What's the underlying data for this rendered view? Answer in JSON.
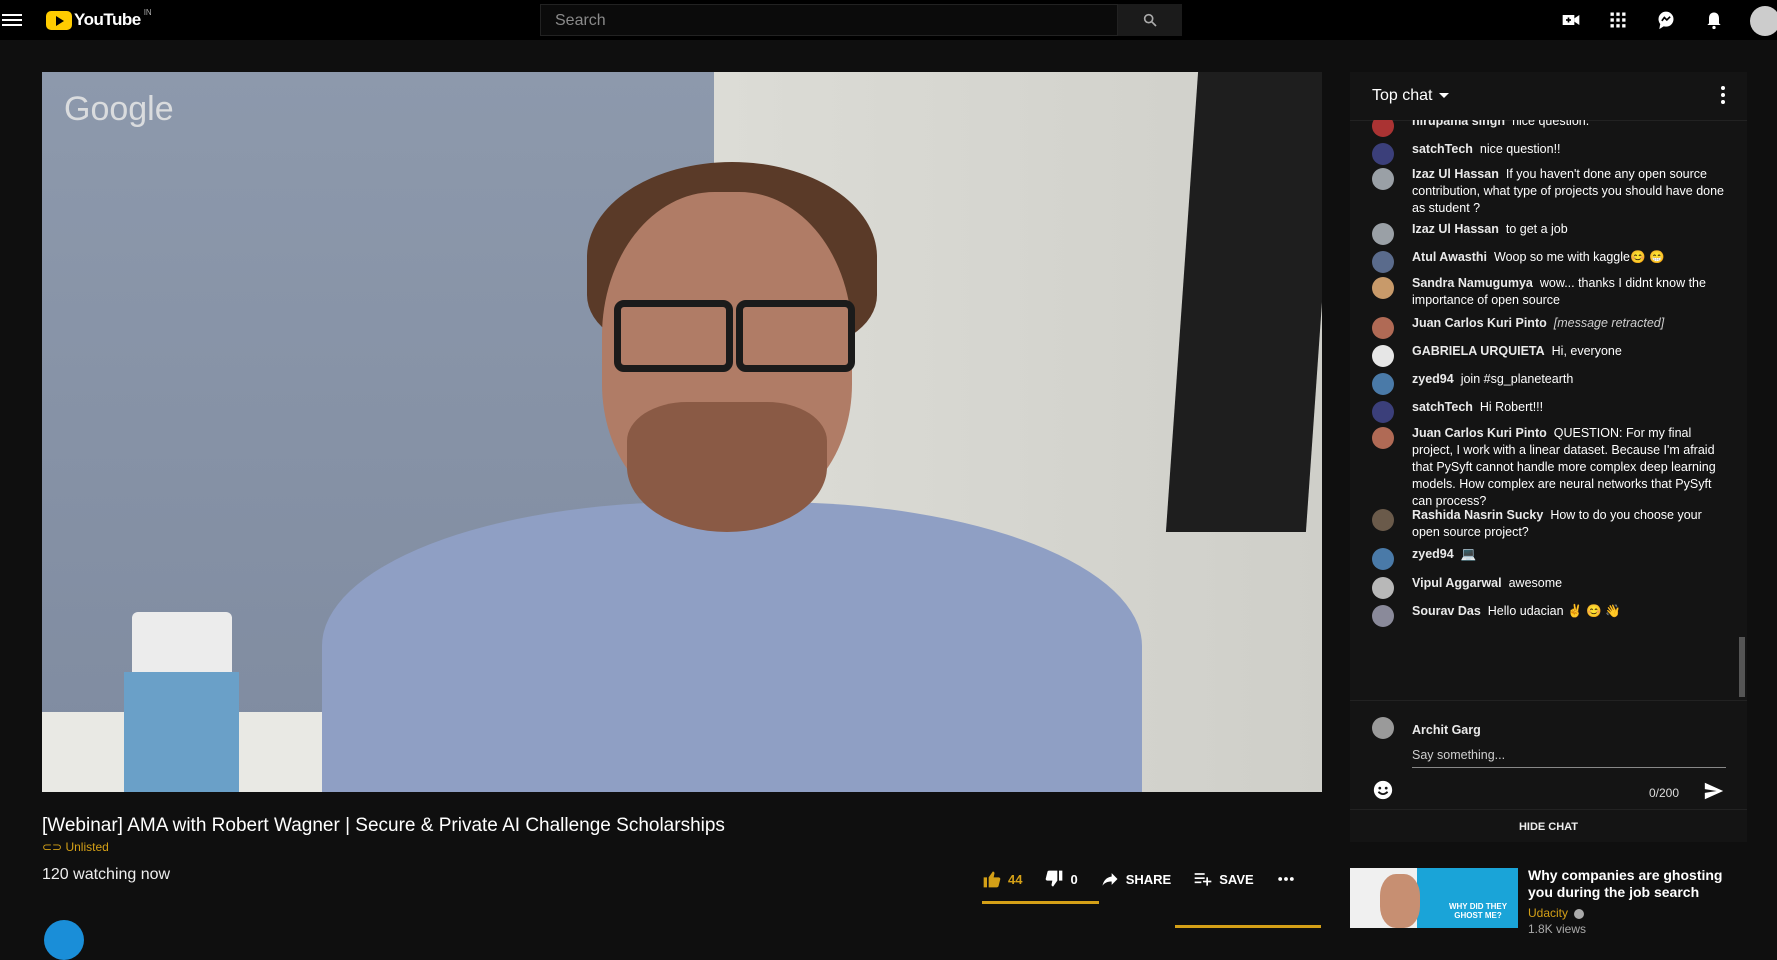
{
  "header": {
    "logo_text": "YouTube",
    "region": "IN",
    "search_placeholder": "Search"
  },
  "video": {
    "watermark": "Google",
    "title": "[Webinar] AMA with Robert Wagner | Secure & Private AI Challenge Scholarships",
    "visibility": "Unlisted",
    "watching": "120 watching now"
  },
  "actions": {
    "likes": "44",
    "dislikes": "0",
    "share": "SHARE",
    "save": "SAVE"
  },
  "chat": {
    "mode": "Top chat",
    "messages": [
      {
        "author": "nirupama singh",
        "text": "nice question.",
        "avatar": "#a33"
      },
      {
        "author": "satchTech",
        "text": "nice question!!",
        "avatar": "#3b3f7a"
      },
      {
        "author": "Izaz Ul Hassan",
        "text": "If you haven't done any open source contribution, what type of projects you should have done as student ?",
        "avatar": "#9aa0a6"
      },
      {
        "author": "Izaz Ul Hassan",
        "text": "to get a job",
        "avatar": "#9aa0a6"
      },
      {
        "author": "Atul Awasthi",
        "text": "Woop so me with kaggle😊 😁",
        "avatar": "#5a6b8c"
      },
      {
        "author": "Sandra Namugumya",
        "text": "wow... thanks I didnt know the importance of open source",
        "avatar": "#c89a6a"
      },
      {
        "author": "Juan Carlos Kuri Pinto",
        "text": "[message retracted]",
        "avatar": "#b06a55"
      },
      {
        "author": "GABRIELA URQUIETA",
        "text": "Hi, everyone",
        "avatar": "#e6e6e6"
      },
      {
        "author": "zyed94",
        "text": "join #sg_planetearth",
        "avatar": "#4a7aa8"
      },
      {
        "author": "satchTech",
        "text": "Hi Robert!!!",
        "avatar": "#3b3f7a"
      },
      {
        "author": "Juan Carlos Kuri Pinto",
        "text": "QUESTION: For my final project, I work with a linear dataset. Because I'm afraid that PySyft cannot handle more complex deep learning models. How complex are neural networks that PySyft can process?",
        "avatar": "#b06a55"
      },
      {
        "author": "Rashida Nasrin Sucky",
        "text": "How to do you choose your open source project?",
        "avatar": "#6a5a4a"
      },
      {
        "author": "zyed94",
        "text": "💻",
        "avatar": "#4a7aa8"
      },
      {
        "author": "Vipul Aggarwal",
        "text": "awesome",
        "avatar": "#b8b8b8"
      },
      {
        "author": "Sourav Das",
        "text": "Hello udacian ✌ 😊 👋",
        "avatar": "#8a8a9a"
      }
    ],
    "current_user": "Archit Garg",
    "input_placeholder": "Say something...",
    "char_count": "0/200",
    "hide_chat": "HIDE CHAT"
  },
  "recommendation": {
    "title": "Why companies are ghosting you during the job search",
    "thumb_text": "WHY DID THEY GHOST ME?",
    "channel": "Udacity",
    "views": "1.8K views"
  },
  "colors": {
    "accent": "#d4a017",
    "background": "#0f0f0f",
    "chat_bg": "#141414"
  }
}
